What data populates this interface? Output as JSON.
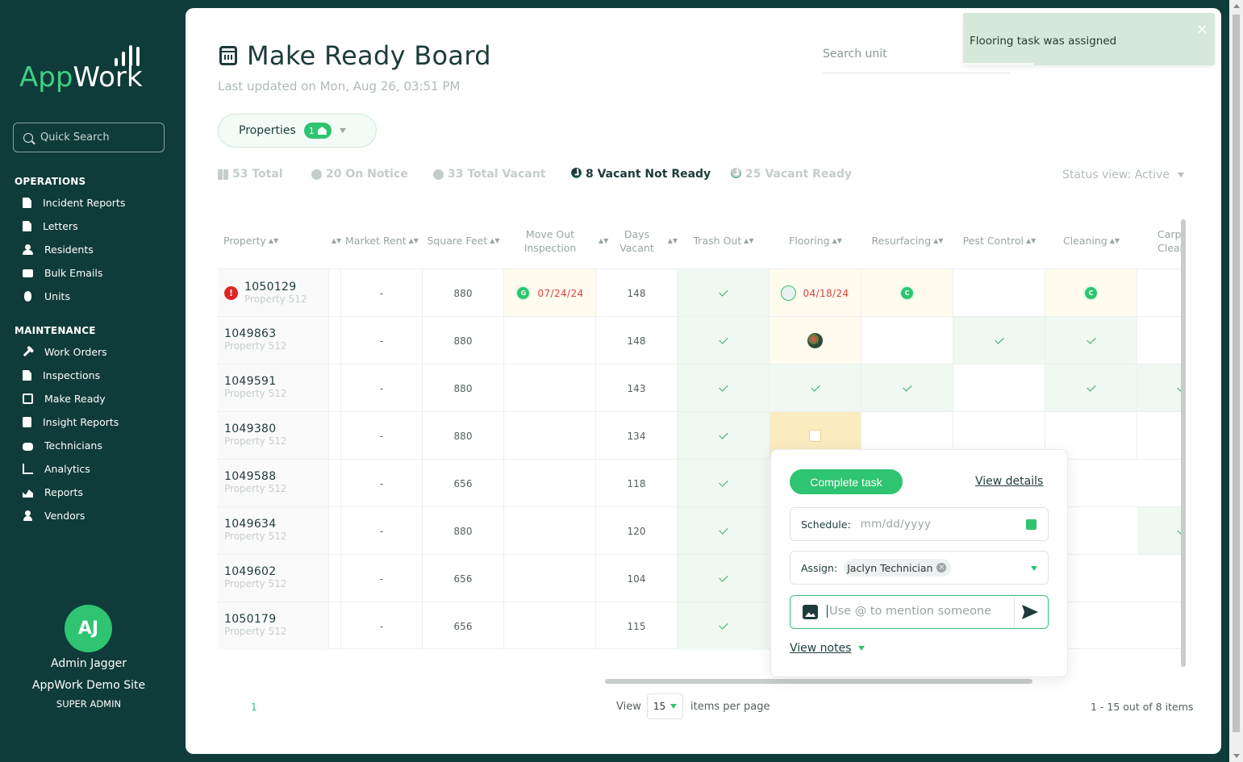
{
  "brand": {
    "logo_prefix": "App",
    "logo_suffix": "Work"
  },
  "sidebar": {
    "search_placeholder": "Quick Search",
    "sections": [
      {
        "title": "OPERATIONS",
        "items": [
          {
            "label": "Incident Reports",
            "icon": "document-icon"
          },
          {
            "label": "Letters",
            "icon": "letter-icon"
          },
          {
            "label": "Residents",
            "icon": "people-icon"
          },
          {
            "label": "Bulk Emails",
            "icon": "mail-icon"
          },
          {
            "label": "Units",
            "icon": "units-icon"
          }
        ]
      },
      {
        "title": "MAINTENANCE",
        "items": [
          {
            "label": "Work Orders",
            "icon": "wrench-icon"
          },
          {
            "label": "Inspections",
            "icon": "document-icon"
          },
          {
            "label": "Make Ready",
            "icon": "calendar-check-icon"
          },
          {
            "label": "Insight Reports",
            "icon": "clipboard-icon"
          },
          {
            "label": "Technicians",
            "icon": "robot-icon"
          },
          {
            "label": "Analytics",
            "icon": "chart-icon"
          },
          {
            "label": "Reports",
            "icon": "area-chart-icon"
          },
          {
            "label": "Vendors",
            "icon": "person-icon"
          }
        ]
      }
    ],
    "user": {
      "initials": "AJ",
      "name": "Admin Jagger",
      "site": "AppWork Demo Site",
      "role": "SUPER ADMIN"
    }
  },
  "header": {
    "title": "Make Ready Board",
    "last_updated": "Last updated on Mon, Aug 26, 03:51 PM",
    "search_placeholder": "Search unit",
    "properties_label": "Properties",
    "properties_count": "1"
  },
  "stats": [
    {
      "label": "53 Total",
      "active": false
    },
    {
      "label": "20 On Notice",
      "active": false
    },
    {
      "label": "33 Total Vacant",
      "active": false
    },
    {
      "label": "8 Vacant Not Ready",
      "active": true
    },
    {
      "label": "25 Vacant Ready",
      "active": false
    }
  ],
  "status_view": "Status view: Active",
  "table": {
    "columns": [
      "Property",
      "",
      "Market Rent",
      "Square Feet",
      "Move Out Inspection",
      "Days Vacant",
      "Trash Out",
      "Flooring",
      "Resurfacing",
      "Pest Control",
      "Cleaning",
      "Carpet Clean"
    ],
    "rows": [
      {
        "unit": "1050129",
        "property": "Property 512",
        "market_rent": "-",
        "sqft": "880",
        "days_vacant": "148",
        "move_out": "07/24/24",
        "move_out_badge": "G",
        "flooring_date": "04/18/24",
        "resurfacing_badge": "C",
        "cleaning_badge": "C"
      },
      {
        "unit": "1049863",
        "property": "Property 512",
        "market_rent": "-",
        "sqft": "880",
        "days_vacant": "148"
      },
      {
        "unit": "1049591",
        "property": "Property 512",
        "market_rent": "-",
        "sqft": "880",
        "days_vacant": "143"
      },
      {
        "unit": "1049380",
        "property": "Property 512",
        "market_rent": "-",
        "sqft": "880",
        "days_vacant": "134"
      },
      {
        "unit": "1049588",
        "property": "Property 512",
        "market_rent": "-",
        "sqft": "656",
        "days_vacant": "118"
      },
      {
        "unit": "1049634",
        "property": "Property 512",
        "market_rent": "-",
        "sqft": "880",
        "days_vacant": "120"
      },
      {
        "unit": "1049602",
        "property": "Property 512",
        "market_rent": "-",
        "sqft": "656",
        "days_vacant": "104"
      },
      {
        "unit": "1050179",
        "property": "Property 512",
        "market_rent": "-",
        "sqft": "656",
        "days_vacant": "115"
      }
    ]
  },
  "pagination": {
    "page": "1",
    "view_label": "View",
    "per_page": "15",
    "per_page_label": "items per page",
    "count": "1 - 15 out of 8 items"
  },
  "popover": {
    "complete_label": "Complete task",
    "details_label": "View details",
    "schedule_label": "Schedule:",
    "schedule_placeholder": "mm/dd/yyyy",
    "assign_label": "Assign:",
    "assignee": "Jaclyn Technician",
    "message_placeholder": "Use @ to mention someone",
    "notes_label": "View notes"
  },
  "toast": {
    "message": "Flooring task was assigned",
    "close": "×"
  },
  "colors": {
    "sidebar": "#0f3b3a",
    "accent": "#2ec471",
    "alert": "#e02424"
  }
}
